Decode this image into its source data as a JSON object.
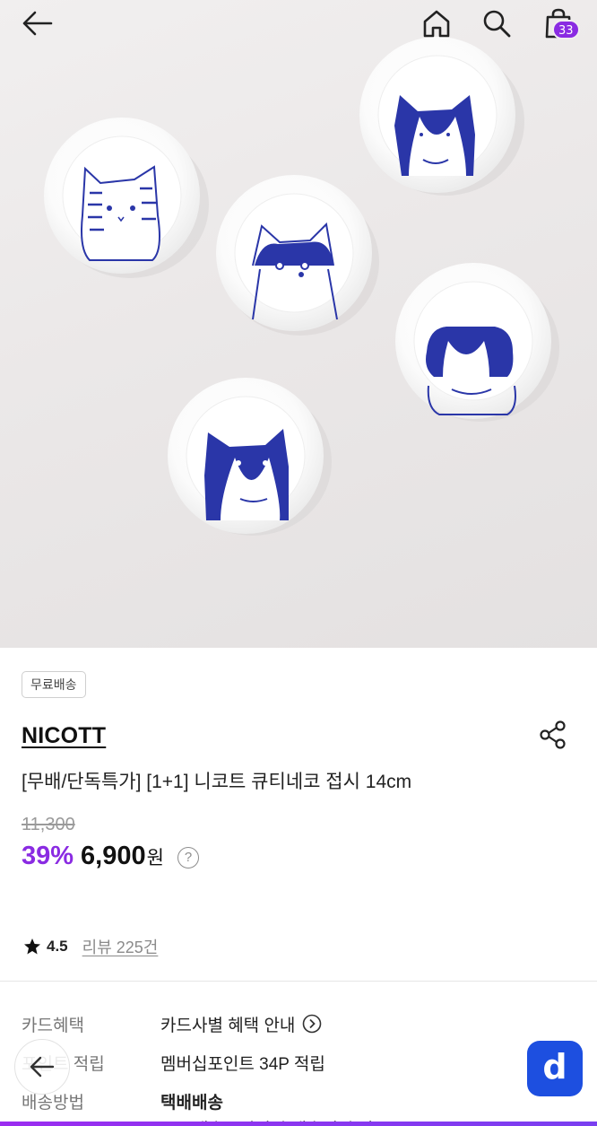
{
  "header": {
    "cart_count": "33",
    "icons": [
      "back-arrow-icon",
      "home-icon",
      "search-icon",
      "shopping-bag-icon"
    ]
  },
  "hero": {
    "image_subject": "five white plates with blue cat illustrations"
  },
  "product": {
    "badge": "무료배송",
    "brand": "NICOTT",
    "title": "[무배/단독특가] [1+1] 니코트 큐티네코 접시 14cm",
    "original_price": "11,300",
    "discount": "39%",
    "price": "6,900",
    "currency": "원",
    "price_help": "?",
    "rating": "4.5",
    "review_link": "리뷰 225건"
  },
  "info": {
    "rows": [
      {
        "label": "카드혜택",
        "value": "카드사별 혜택 안내"
      },
      {
        "label": "포인트 적립",
        "value": "멤버십포인트 34P 적립"
      },
      {
        "label": "배송방법",
        "value": "택배배송"
      }
    ],
    "partial_line": "무료배송 · 일정시 배송비 추가"
  },
  "floating": {
    "app_button": "d"
  },
  "colors": {
    "accent": "#8a2be2",
    "app_blue": "#1d4fe0"
  }
}
